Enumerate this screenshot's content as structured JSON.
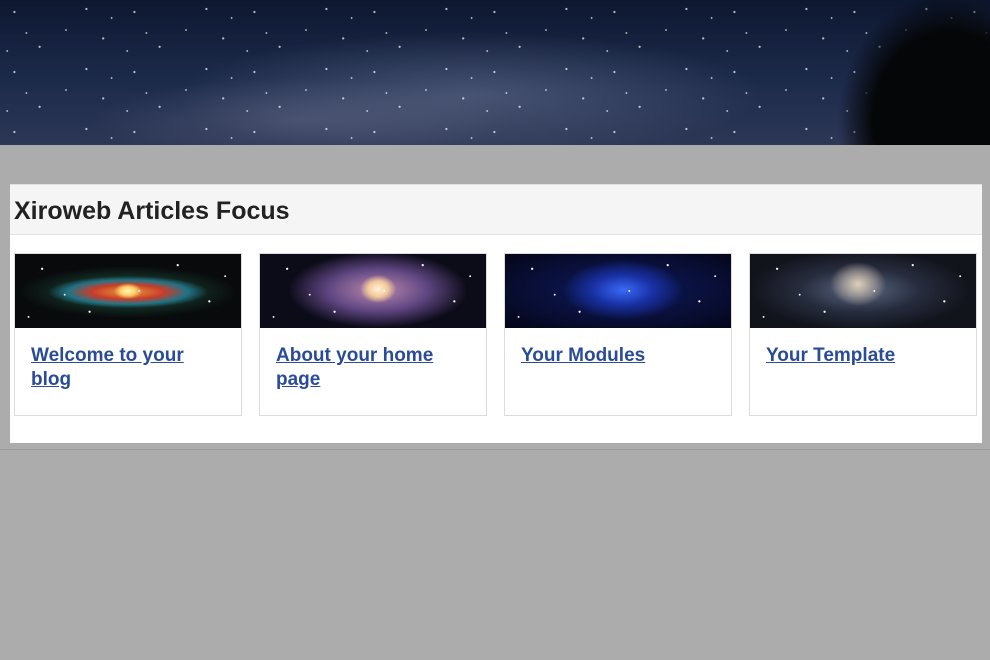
{
  "hero": {
    "image": "starry-night-sky-banner"
  },
  "module": {
    "title": "Xiroweb Articles Focus",
    "articles": [
      {
        "title": "Welcome to your blog",
        "image": "andromeda-galaxy"
      },
      {
        "title": "About your home page",
        "image": "spiral-galaxy-m81"
      },
      {
        "title": "Your Modules",
        "image": "blue-galaxy-cluster"
      },
      {
        "title": "Your Template",
        "image": "spiral-galaxy"
      }
    ]
  },
  "colors": {
    "page_background": "#acacac",
    "link": "#2a4b9a",
    "title_text": "#222222",
    "header_background": "#f5f5f5"
  }
}
